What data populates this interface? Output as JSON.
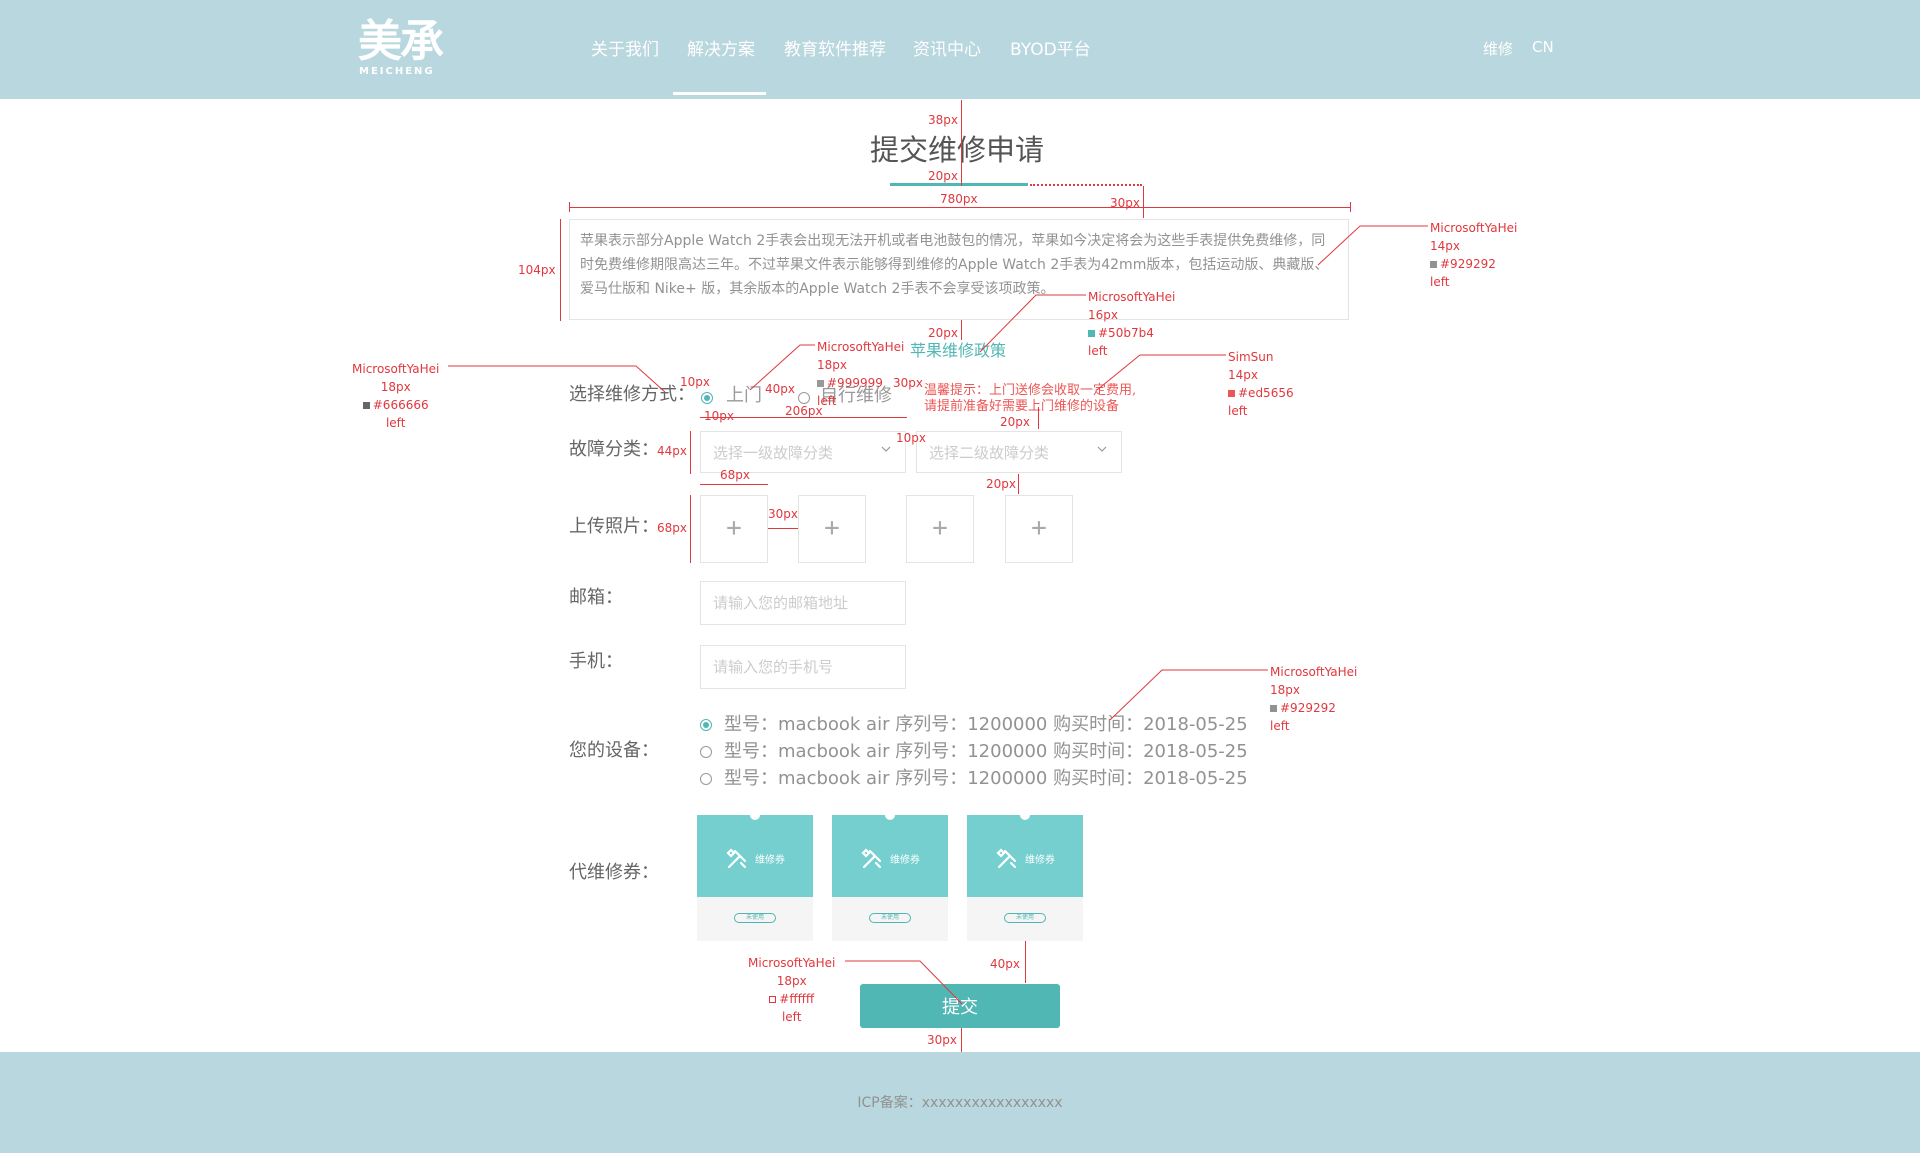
{
  "header": {
    "logo_cn": "美承",
    "logo_en": "MEICHENG",
    "nav": [
      "关于我们",
      "解决方案",
      "教育软件推荐",
      "资讯中心",
      "BYOD平台"
    ],
    "active_nav": "解决方案",
    "right_links": [
      "维修",
      "CN"
    ]
  },
  "page": {
    "title": "提交维修申请",
    "intro": "苹果表示部分Apple Watch 2手表会出现无法开机或者电池鼓包的情况，苹果如今决定将会为这些手表提供免费维修，同时免费维修期限高达三年。不过苹果文件表示能够得到维修的Apple Watch 2手表为42mm版本，包括运动版、典藏版、爱马仕版和 Nike+ 版，其余版本的Apple Watch 2手表不会享受该项政策。",
    "policy_link": "苹果维修政策"
  },
  "form": {
    "method_label": "选择维修方式：",
    "method_options": [
      "上门",
      "自行维修"
    ],
    "method_selected": "上门",
    "tip": [
      "温馨提示：上门送修会收取一定费用,",
      "请提前准备好需要上门维修的设备"
    ],
    "fault_label": "故障分类：",
    "select1_placeholder": "选择一级故障分类",
    "select2_placeholder": "选择二级故障分类",
    "upload_label": "上传照片：",
    "upload_glyph": "+",
    "email_label": "邮箱：",
    "email_placeholder": "请输入您的邮箱地址",
    "phone_label": "手机：",
    "phone_placeholder": "请输入您的手机号",
    "device_label": "您的设备：",
    "devices": [
      "型号：macbook air  序列号：1200000  购买时间：2018-05-25",
      "型号：macbook air  序列号：1200000  购买时间：2018-05-25",
      "型号：macbook air  序列号：1200000  购买时间：2018-05-25"
    ],
    "device_selected_index": 0,
    "coupon_label": "代维修券：",
    "coupons": [
      {
        "title": "维修券",
        "badge": "未使用"
      },
      {
        "title": "维修券",
        "badge": "未使用"
      },
      {
        "title": "维修券",
        "badge": "未使用"
      }
    ],
    "submit_label": "提交"
  },
  "footer": {
    "icp": "ICP备案：xxxxxxxxxxxxxxxxx"
  },
  "annotations": {
    "spacing": [
      "38px",
      "20px",
      "780px",
      "30px",
      "104px",
      "20px",
      "10px",
      "40px",
      "30px",
      "10px",
      "206px",
      "20px",
      "44px",
      "10px",
      "68px",
      "20px",
      "30px",
      "68px",
      "40px",
      "30px"
    ],
    "intro_spec": [
      "MicrosoftYaHei",
      "14px",
      "#929292",
      "left"
    ],
    "policy_spec": [
      "MicrosoftYaHei",
      "16px",
      "#50b7b4",
      "left"
    ],
    "option_spec": [
      "MicrosoftYaHei",
      "18px",
      "#999999",
      "left"
    ],
    "label_spec": [
      "MicrosoftYaHei",
      "18px",
      "#666666",
      "left"
    ],
    "tip_spec": [
      "SimSun",
      "14px",
      "#ed5656",
      "left"
    ],
    "device_spec": [
      "MicrosoftYaHei",
      "18px",
      "#929292",
      "left"
    ],
    "button_spec": [
      "MicrosoftYaHei",
      "18px",
      "#ffffff",
      "left"
    ]
  },
  "colors": {
    "header_bg": "#b8d7de",
    "accent": "#50b7b4",
    "coupon": "#76cfcf",
    "annotation": "#e0383e"
  }
}
